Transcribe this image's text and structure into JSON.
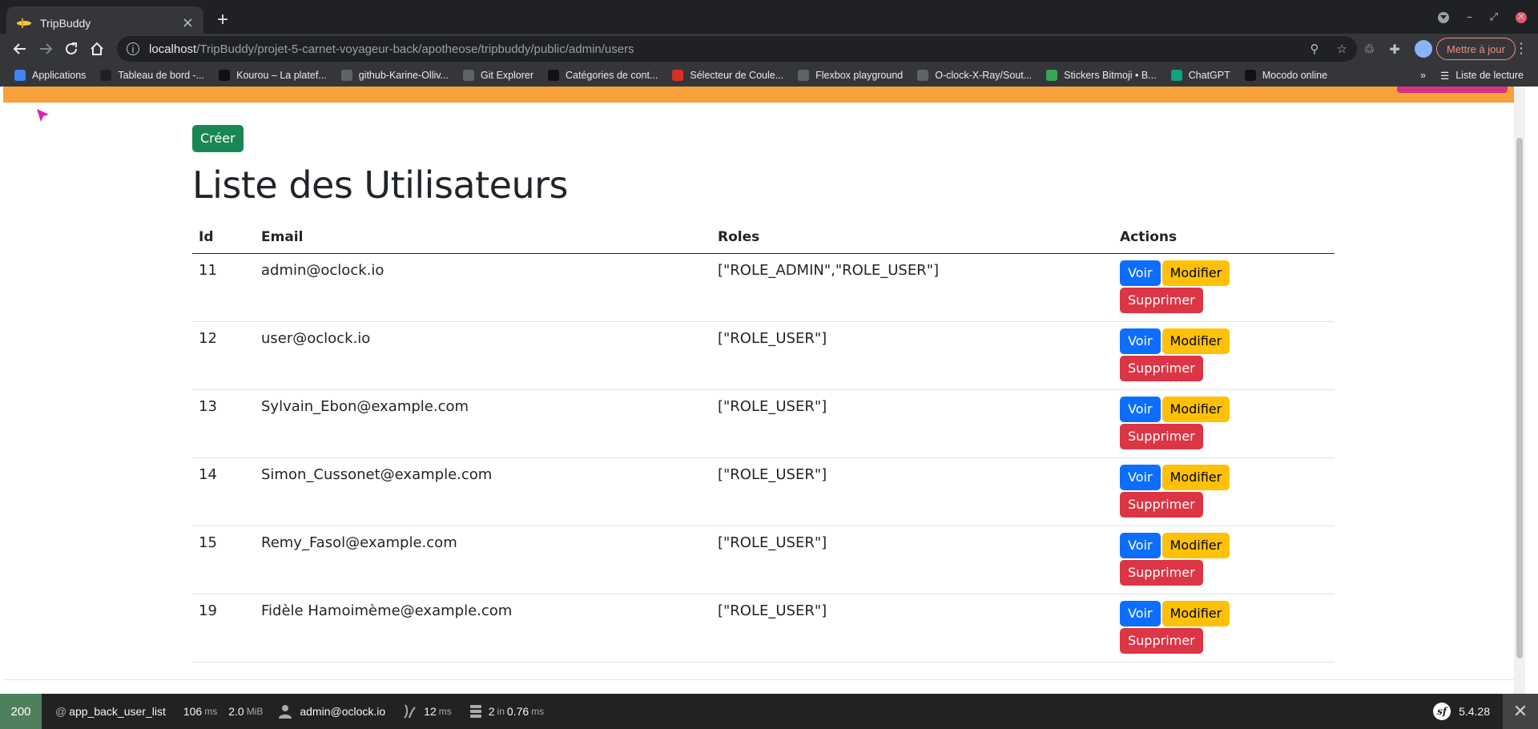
{
  "browser": {
    "tab_title": "TripBuddy",
    "url_host": "localhost",
    "url_path": "/TripBuddy/projet-5-carnet-voyageur-back/apotheose/tripbuddy/public/admin/users",
    "update_label": "Mettre à jour",
    "bookmarks": [
      {
        "label": "Applications",
        "icon": "apps-grid-icon",
        "color": "#4285f4"
      },
      {
        "label": "Tableau de bord -...",
        "icon": "s-icon",
        "color": "#202124"
      },
      {
        "label": "Kourou – La platef...",
        "icon": "dark-circle-icon",
        "color": "#111111"
      },
      {
        "label": "github-Karine-Olliv...",
        "icon": "github-icon",
        "color": "#5f6368"
      },
      {
        "label": "Git Explorer",
        "icon": "globe-icon",
        "color": "#5f6368"
      },
      {
        "label": "Catégories de cont...",
        "icon": "m-icon",
        "color": "#111111"
      },
      {
        "label": "Sélecteur de Coule...",
        "icon": "color-picker-icon",
        "color": "#d93025"
      },
      {
        "label": "Flexbox playground",
        "icon": "flexbox-icon",
        "color": "#5f6368"
      },
      {
        "label": "O-clock-X-Ray/Sout...",
        "icon": "github-icon",
        "color": "#5f6368"
      },
      {
        "label": "Stickers Bitmoji • B...",
        "icon": "bitmoji-icon",
        "color": "#34a853"
      },
      {
        "label": "ChatGPT",
        "icon": "chatgpt-icon",
        "color": "#10a37f"
      },
      {
        "label": "Mocodo online",
        "icon": "m-icon",
        "color": "#111111"
      }
    ],
    "reading_list_label": "Liste de lecture"
  },
  "page": {
    "create_label": "Créer",
    "title": "Liste des Utilisateurs",
    "columns": [
      "Id",
      "Email",
      "Roles",
      "Actions"
    ],
    "action_labels": {
      "view": "Voir",
      "edit": "Modifier",
      "delete": "Supprimer"
    },
    "rows": [
      {
        "id": "11",
        "email": "admin@oclock.io",
        "roles": "[\"ROLE_ADMIN\",\"ROLE_USER\"]"
      },
      {
        "id": "12",
        "email": "user@oclock.io",
        "roles": "[\"ROLE_USER\"]"
      },
      {
        "id": "13",
        "email": "Sylvain_Ebon@example.com",
        "roles": "[\"ROLE_USER\"]"
      },
      {
        "id": "14",
        "email": "Simon_Cussonet@example.com",
        "roles": "[\"ROLE_USER\"]"
      },
      {
        "id": "15",
        "email": "Remy_Fasol@example.com",
        "roles": "[\"ROLE_USER\"]"
      },
      {
        "id": "19",
        "email": "Fidèle Hamoimème@example.com",
        "roles": "[\"ROLE_USER\"]"
      }
    ],
    "colors": {
      "create": "#198754",
      "view": "#0d6efd",
      "edit": "#ffc107",
      "delete": "#dc3545",
      "header_bar": "#f7a03c"
    }
  },
  "toolbar": {
    "status_code": "200",
    "route_prefix": "@",
    "route": "app_back_user_list",
    "time_value": "106",
    "time_unit": "ms",
    "memory_value": "2.0",
    "memory_unit": "MiB",
    "user": "admin@oclock.io",
    "twig_value": "12",
    "twig_unit": "ms",
    "db_count": "2",
    "db_in": "in",
    "db_time": "0.76",
    "db_unit": "ms",
    "version": "5.4.28"
  }
}
